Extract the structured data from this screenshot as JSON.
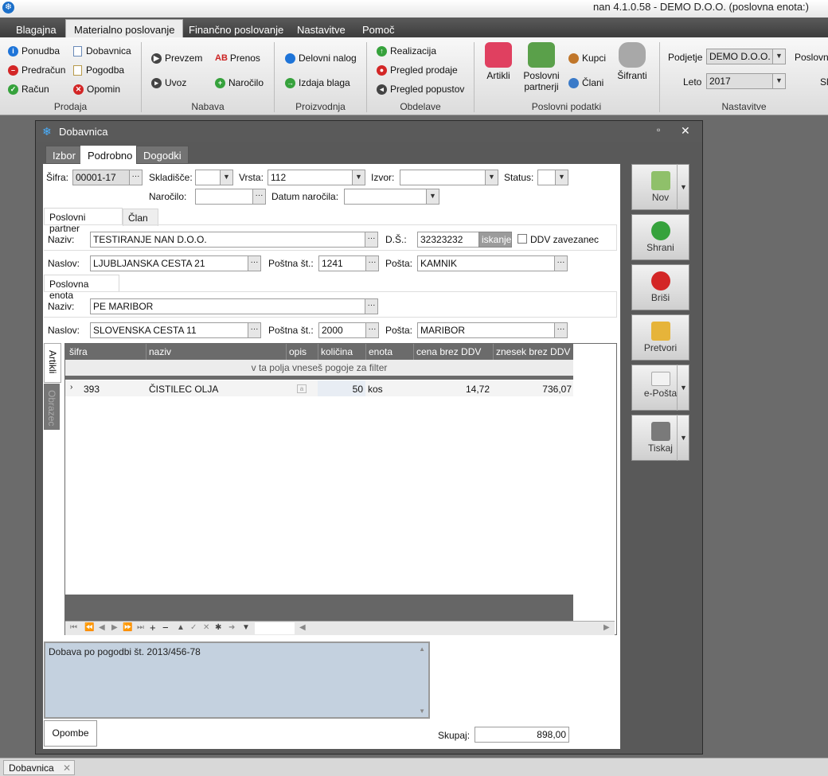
{
  "app": {
    "title": "nan 4.1.0.58 - DEMO D.O.O. (poslovna enota:)",
    "logo_glyph": "❄"
  },
  "menu_tabs": [
    "Blagajna",
    "Materialno poslovanje",
    "Finančno poslovanje",
    "Nastavitve",
    "Pomoč"
  ],
  "ribbon": {
    "prodaja": {
      "label": "Prodaja",
      "items": [
        "Ponudba",
        "Dobavnica",
        "Predračun",
        "Pogodba",
        "Račun",
        "Opomin"
      ]
    },
    "nabava": {
      "label": "Nabava",
      "items": [
        "Prevzem",
        "Prenos",
        "Uvoz",
        "Naročilo"
      ]
    },
    "proizvodnja": {
      "label": "Proizvodnja",
      "items": [
        "Delovni nalog",
        "Izdaja blaga"
      ]
    },
    "obdelave": {
      "label": "Obdelave",
      "items": [
        "Realizacija",
        "Pregled prodaje",
        "Pregled popustov"
      ]
    },
    "poslovni_podatki": {
      "label": "Poslovni podatki",
      "items": [
        "Artikli",
        "Poslovni partnerji",
        "Kupci",
        "Člani",
        "Šifranti"
      ]
    },
    "nastavitve": {
      "label": "Nastavitve",
      "podjetje_label": "Podjetje",
      "podjetje_value": "DEMO D.O.O.",
      "leto_label": "Leto",
      "leto_value": "2017",
      "extra1": "Poslovni",
      "extra2": "Sl"
    }
  },
  "window": {
    "title": "Dobavnica",
    "tabs": [
      "Izbor",
      "Podrobno",
      "Dogodki"
    ]
  },
  "form": {
    "sifra_label": "Šifra:",
    "sifra_value": "00001-17",
    "skladisce_label": "Skladišče:",
    "skladisce_value": "",
    "vrsta_label": "Vrsta:",
    "vrsta_value": "112",
    "izvor_label": "Izvor:",
    "izvor_value": "",
    "status_label": "Status:",
    "status_value": "",
    "narocilo_label": "Naročilo:",
    "narocilo_value": "",
    "datum_narocila_label": "Datum naročila:",
    "datum_narocila_value": "",
    "partner_tabs": [
      "Poslovni partner",
      "Član"
    ],
    "partner": {
      "naziv_label": "Naziv:",
      "naziv_value": "TESTIRANJE NAN D.O.O.",
      "ds_label": "D.Š.:",
      "ds_value": "32323232",
      "iskanje_label": "iskanje",
      "ddv_label": "DDV zavezanec",
      "naslov_label": "Naslov:",
      "naslov_value": "LJUBLJANSKA CESTA 21",
      "postna_label": "Poštna št.:",
      "postna_value": "1241",
      "posta_label": "Pošta:",
      "posta_value": "KAMNIK"
    },
    "enota_tab": "Poslovna enota",
    "enota": {
      "naziv_label": "Naziv:",
      "naziv_value": "PE MARIBOR",
      "naslov_label": "Naslov:",
      "naslov_value": "SLOVENSKA CESTA 11",
      "postna_label": "Poštna št.:",
      "postna_value": "2000",
      "posta_label": "Pošta:",
      "posta_value": "MARIBOR"
    }
  },
  "grid": {
    "side_tabs": [
      "Artikli",
      "Obrazec"
    ],
    "columns": [
      "šifra",
      "naziv",
      "opis",
      "količina",
      "enota",
      "cena brez DDV",
      "znesek brez DDV"
    ],
    "filter_hint": "v ta polja vneseš pogoje za filter",
    "rows": [
      {
        "sifra": "393",
        "naziv": "ČISTILEC OLJA",
        "opis": "a",
        "kolicina": "50",
        "enota": "kos",
        "cena": "14,72",
        "znesek": "736,07"
      }
    ]
  },
  "notes": {
    "text": "Dobava po pogodbi št. 2013/456-78",
    "tab": "Opombe"
  },
  "total": {
    "label": "Skupaj:",
    "value": "898,00"
  },
  "actions": [
    "Nov",
    "Shrani",
    "Briši",
    "Pretvori",
    "e-Pošta",
    "Tiskaj"
  ],
  "statusbar": {
    "tab": "Dobavnica",
    "close": "✕"
  }
}
